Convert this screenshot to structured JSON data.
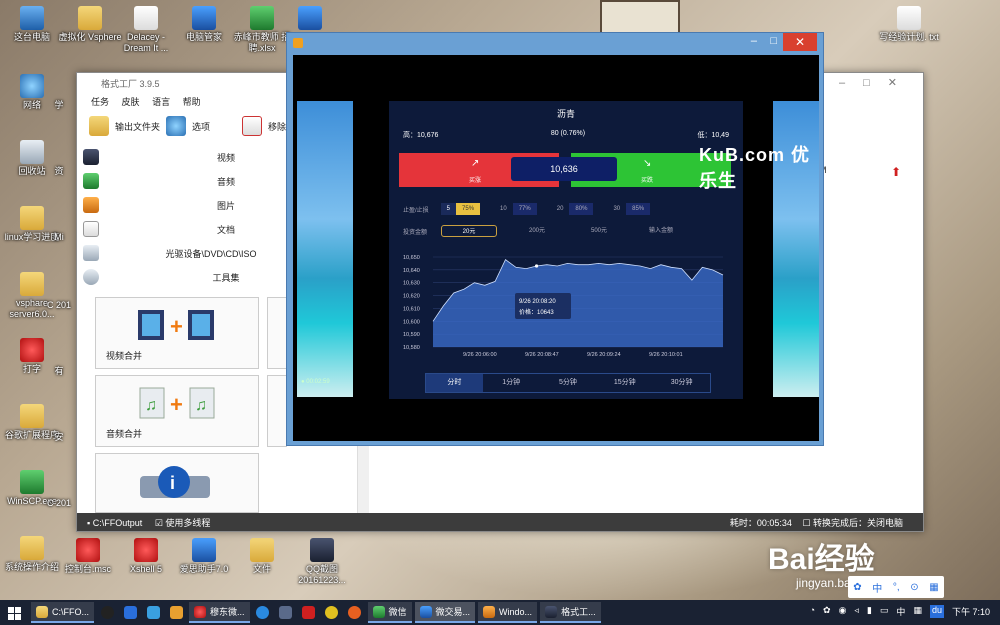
{
  "desktop": {
    "icons_left": [
      {
        "label": "这台电脑",
        "icon": "pc-icon"
      },
      {
        "label": "网络",
        "icon": "network-icon"
      },
      {
        "label": "回收站",
        "icon": "recycle-bin-icon"
      },
      {
        "label": "linux学习进度",
        "icon": "folder-icon"
      },
      {
        "label": "vsphare server6.0...",
        "icon": "folder-icon"
      },
      {
        "label": "打字",
        "icon": "red-app-icon"
      },
      {
        "label": "谷歌扩展程序",
        "icon": "folder-icon"
      },
      {
        "label": "WinSCP.exe",
        "icon": "winscp-icon"
      },
      {
        "label": "系统操作介绍",
        "icon": "folder-icon"
      }
    ],
    "icons_top": [
      {
        "label": "虚拟化 Vsphere",
        "icon": "folder-icon"
      },
      {
        "label": "Delacey - Dream It ...",
        "icon": "mp3-icon"
      },
      {
        "label": "电脑管家",
        "icon": "shield-app-icon"
      },
      {
        "label": "赤峰市教师 招聘.xlsx",
        "icon": "excel-icon"
      }
    ],
    "icons_bottom": [
      {
        "label": "控制台.msc",
        "icon": "console-icon"
      },
      {
        "label": "Xshell 5",
        "icon": "xshell-icon"
      },
      {
        "label": "爱思助手7.0",
        "icon": "i4-icon"
      },
      {
        "label": "文件",
        "icon": "folder-icon"
      },
      {
        "label": "QQ截图 20161223...",
        "icon": "screenshot-icon"
      }
    ],
    "icon_top_right": {
      "label": "写经验计划. txt",
      "icon": "txt-icon"
    },
    "partial_labels": [
      "学",
      "资",
      "Mi",
      "C 201",
      "有",
      "安",
      "C 201"
    ]
  },
  "ff_window": {
    "title": "格式工厂 3.9.5",
    "menu": [
      "任务",
      "皮肤",
      "语言",
      "帮助"
    ],
    "toolbar": {
      "output_folder": "输出文件夹",
      "options": "选项",
      "remove": "移除"
    },
    "categories": [
      "视频",
      "音频",
      "图片",
      "文档",
      "光驱设备\\DVD\\CD\\ISO",
      "工具集"
    ],
    "tiles": [
      "视频合并",
      "音频合并",
      ""
    ],
    "status_left": "C:\\FFOutput",
    "multi_thread": "使用多线程",
    "elapsed": "耗时：00:05:34",
    "after_convert": "转换完成后：关闭电脑",
    "side_text": "M"
  },
  "player": {
    "app": {
      "title": "沥青",
      "high": "高：10,676",
      "change": "80 (0.76%)",
      "low": "低：10,49",
      "buy_up": "买涨",
      "buy_down": "买跌",
      "price": "10,636",
      "stop_label": "止盈/止损",
      "stop_options": [
        "5",
        "75%",
        "10",
        "77%",
        "20",
        "80%",
        "30",
        "85%"
      ],
      "invest_label": "投资金额",
      "invest_options": [
        "20元",
        "200元",
        "500元",
        "输入金额"
      ],
      "tooltip_time": "9/26 20:08:20",
      "tooltip_price": "价格：10643",
      "tabs": [
        "分时",
        "1分钟",
        "5分钟",
        "15分钟",
        "30分钟"
      ],
      "timer": "00:02:59"
    },
    "brand": "KuB.com 优乐生"
  },
  "chart_data": {
    "type": "line",
    "title": "",
    "xlabel": "",
    "ylabel": "",
    "ylim": [
      10580,
      10650
    ],
    "y_ticks": [
      "10,650",
      "10,640",
      "10,630",
      "10,620",
      "10,610",
      "10,600",
      "10,590",
      "10,580"
    ],
    "x_ticks": [
      "9/26 20:06:00",
      "9/26 20:08:47",
      "9/26 20:09:24",
      "9/26 20:10:01"
    ],
    "series": [
      {
        "values": [
          10600,
          10612,
          10622,
          10625,
          10630,
          10628,
          10631,
          10648,
          10642,
          10641,
          10643,
          10644,
          10643,
          10645,
          10644,
          10644,
          10645,
          10644,
          10645,
          10644,
          10643,
          10641,
          10644,
          10642,
          10641,
          10632,
          10642,
          10640,
          10636
        ]
      }
    ]
  },
  "taskbar": {
    "buttons": [
      "C:\\FFO...",
      "穆东微...",
      "微信",
      "微交易...",
      "Windo...",
      "格式工..."
    ],
    "ime": "中",
    "clock": "下午 7:10",
    "du": "du"
  },
  "watermark": {
    "text": "Bai经验",
    "url": "jingyan.baidu.com"
  },
  "ime_bar": [
    "中",
    "°,",
    "⊙"
  ]
}
